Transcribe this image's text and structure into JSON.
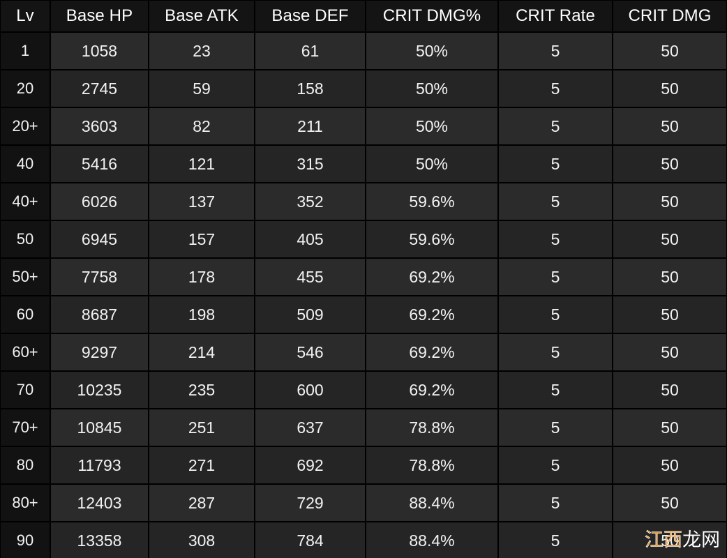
{
  "table": {
    "columns": [
      "Lv",
      "Base HP",
      "Base ATK",
      "Base DEF",
      "CRIT DMG%",
      "CRIT Rate",
      "CRIT DMG"
    ],
    "rows": [
      {
        "lv": "1",
        "base_hp": "1058",
        "base_atk": "23",
        "base_def": "61",
        "crit_dmg_pct": "50%",
        "crit_rate": "5",
        "crit_dmg": "50"
      },
      {
        "lv": "20",
        "base_hp": "2745",
        "base_atk": "59",
        "base_def": "158",
        "crit_dmg_pct": "50%",
        "crit_rate": "5",
        "crit_dmg": "50"
      },
      {
        "lv": "20+",
        "base_hp": "3603",
        "base_atk": "82",
        "base_def": "211",
        "crit_dmg_pct": "50%",
        "crit_rate": "5",
        "crit_dmg": "50"
      },
      {
        "lv": "40",
        "base_hp": "5416",
        "base_atk": "121",
        "base_def": "315",
        "crit_dmg_pct": "50%",
        "crit_rate": "5",
        "crit_dmg": "50"
      },
      {
        "lv": "40+",
        "base_hp": "6026",
        "base_atk": "137",
        "base_def": "352",
        "crit_dmg_pct": "59.6%",
        "crit_rate": "5",
        "crit_dmg": "50"
      },
      {
        "lv": "50",
        "base_hp": "6945",
        "base_atk": "157",
        "base_def": "405",
        "crit_dmg_pct": "59.6%",
        "crit_rate": "5",
        "crit_dmg": "50"
      },
      {
        "lv": "50+",
        "base_hp": "7758",
        "base_atk": "178",
        "base_def": "455",
        "crit_dmg_pct": "69.2%",
        "crit_rate": "5",
        "crit_dmg": "50"
      },
      {
        "lv": "60",
        "base_hp": "8687",
        "base_atk": "198",
        "base_def": "509",
        "crit_dmg_pct": "69.2%",
        "crit_rate": "5",
        "crit_dmg": "50"
      },
      {
        "lv": "60+",
        "base_hp": "9297",
        "base_atk": "214",
        "base_def": "546",
        "crit_dmg_pct": "69.2%",
        "crit_rate": "5",
        "crit_dmg": "50"
      },
      {
        "lv": "70",
        "base_hp": "10235",
        "base_atk": "235",
        "base_def": "600",
        "crit_dmg_pct": "69.2%",
        "crit_rate": "5",
        "crit_dmg": "50"
      },
      {
        "lv": "70+",
        "base_hp": "10845",
        "base_atk": "251",
        "base_def": "637",
        "crit_dmg_pct": "78.8%",
        "crit_rate": "5",
        "crit_dmg": "50"
      },
      {
        "lv": "80",
        "base_hp": "11793",
        "base_atk": "271",
        "base_def": "692",
        "crit_dmg_pct": "78.8%",
        "crit_rate": "5",
        "crit_dmg": "50"
      },
      {
        "lv": "80+",
        "base_hp": "12403",
        "base_atk": "287",
        "base_def": "729",
        "crit_dmg_pct": "88.4%",
        "crit_rate": "5",
        "crit_dmg": "50"
      },
      {
        "lv": "90",
        "base_hp": "13358",
        "base_atk": "308",
        "base_def": "784",
        "crit_dmg_pct": "88.4%",
        "crit_rate": "5",
        "crit_dmg": "50"
      }
    ]
  },
  "watermark": {
    "text_accent": "江西",
    "text_plain": "龙网",
    "accent_color": "#e8922c",
    "plain_color": "#ffffff"
  },
  "theme": {
    "page_background": "#000000",
    "header_background": "#141414",
    "lv_cell_background": "#121212",
    "row_light_background": "#2b2b2b",
    "row_dark_background": "#252525",
    "text_color": "#f2f2f2"
  }
}
